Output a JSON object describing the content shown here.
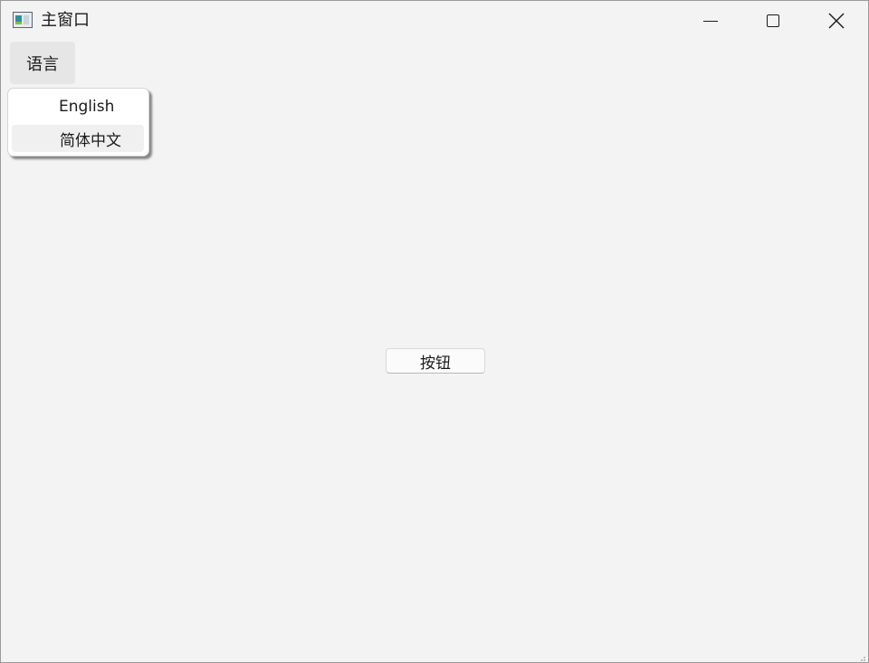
{
  "window": {
    "title": "主窗口",
    "icon": "app-window-icon"
  },
  "titlebar": {
    "minimize_icon": "minimize-icon",
    "maximize_icon": "maximize-icon",
    "close_icon": "close-icon"
  },
  "menubar": {
    "items": [
      {
        "label": "语言"
      }
    ]
  },
  "language_menu": {
    "items": [
      {
        "label": "English",
        "highlighted": false
      },
      {
        "label": "简体中文",
        "highlighted": true
      }
    ]
  },
  "main": {
    "button_label": "按钮"
  },
  "colors": {
    "background": "#f3f3f3",
    "menu_background": "#ffffff",
    "highlight": "#f0f0f0"
  }
}
